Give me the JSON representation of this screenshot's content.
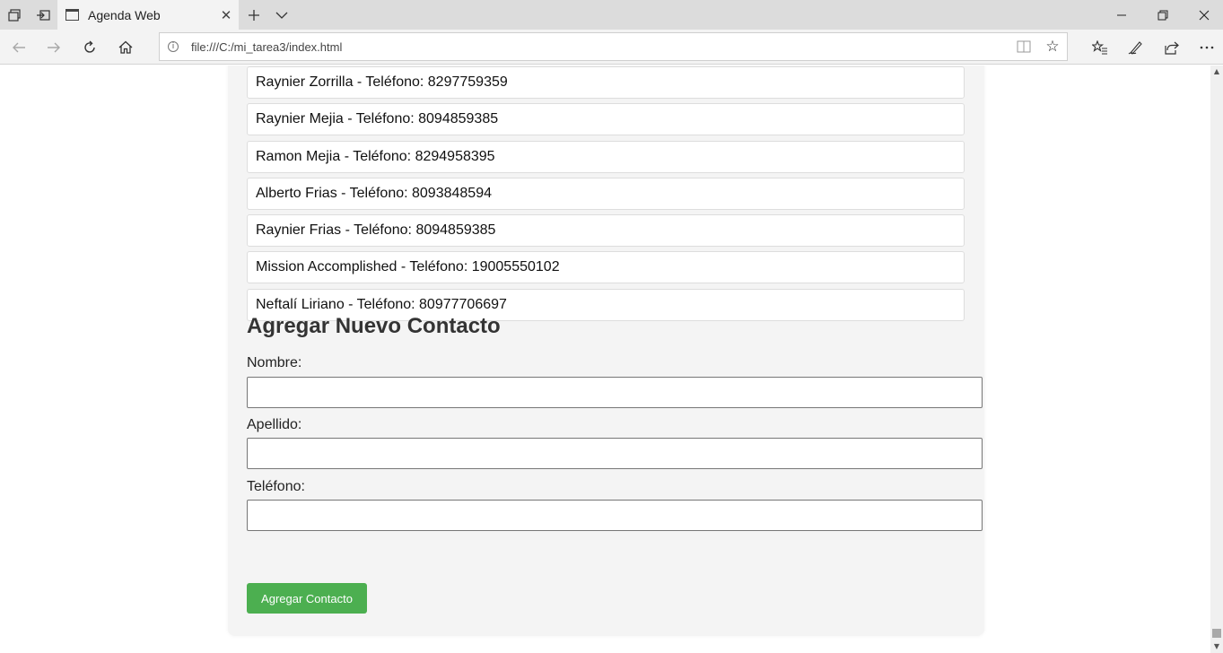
{
  "browser": {
    "tab_title": "Agenda Web",
    "url": "file:///C:/mi_tarea3/index.html",
    "icons": {
      "tab_manager": "tabs-icon",
      "set_aside": "set-aside-tabs-icon",
      "new_tab": "plus-icon",
      "tab_list": "chevron-down-icon",
      "minimize": "minimize-icon",
      "restore": "restore-icon",
      "close": "close-icon",
      "back": "back-arrow-icon",
      "forward": "forward-arrow-icon",
      "refresh": "refresh-icon",
      "home": "home-icon",
      "site_info": "info-icon",
      "reading_view": "book-icon",
      "favorite": "star-icon",
      "favorites_hub": "favorites-list-icon",
      "notes": "pen-icon",
      "share": "share-icon",
      "more": "more-icon"
    }
  },
  "contacts": [
    {
      "text": "Raynier Zorrilla - Teléfono: 8297759359"
    },
    {
      "text": "Raynier Mejia - Teléfono: 8094859385"
    },
    {
      "text": "Ramon Mejia - Teléfono: 8294958395"
    },
    {
      "text": "Alberto Frias - Teléfono: 8093848594"
    },
    {
      "text": "Raynier Frias - Teléfono: 8094859385"
    },
    {
      "text": "Mission Accomplished - Teléfono: 19005550102"
    },
    {
      "text": "Neftalí Liriano - Teléfono: 80977706697"
    }
  ],
  "form": {
    "title": "Agregar Nuevo Contacto",
    "nombre_label": "Nombre:",
    "nombre_value": "",
    "apellido_label": "Apellido:",
    "apellido_value": "",
    "telefono_label": "Teléfono:",
    "telefono_value": "",
    "submit_label": "Agregar Contacto"
  },
  "colors": {
    "button": "#4caf50",
    "container_bg": "#f4f4f4"
  }
}
